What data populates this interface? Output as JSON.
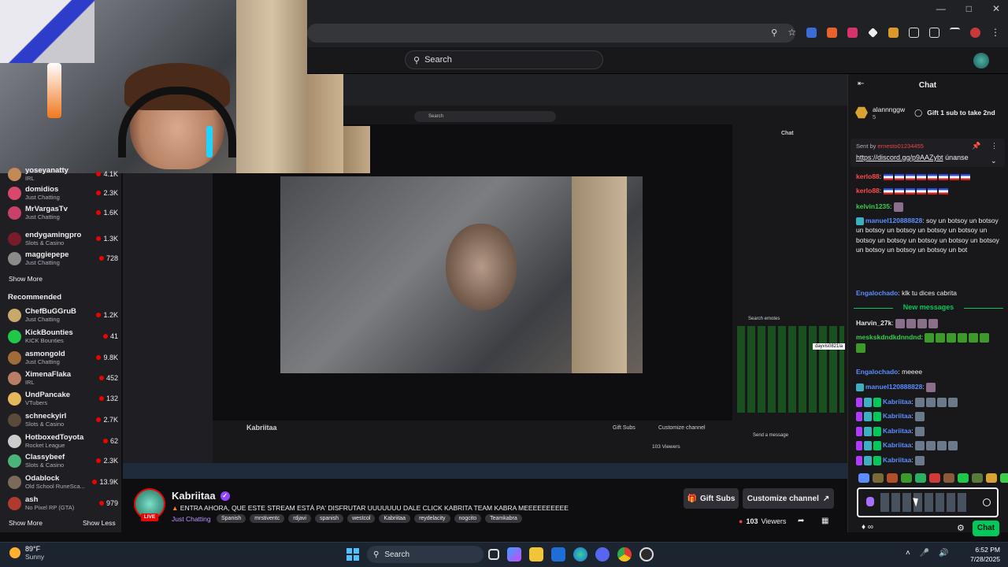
{
  "header": {
    "search_placeholder": "Search"
  },
  "sidebar": {
    "followed": [
      {
        "name": "yoseyanatty",
        "category": "IRL",
        "viewers": "4.1K",
        "color": "#c28a57"
      },
      {
        "name": "domidios",
        "category": "Just Chatting",
        "viewers": "2.3K",
        "color": "#d8486a"
      },
      {
        "name": "MrVargasTv",
        "category": "Just Chatting",
        "viewers": "1.6K",
        "color": "#c9406a"
      },
      {
        "name": "endygamingpro",
        "category": "Slots & Casino",
        "viewers": "1.3K",
        "color": "#7a1b2a"
      },
      {
        "name": "maggiepepe",
        "category": "Just Chatting",
        "viewers": "728",
        "color": "#8a8a8a"
      }
    ],
    "show_more": "Show More",
    "recommended_heading": "Recommended",
    "recommended": [
      {
        "name": "ChefBuGGruB",
        "category": "Just Chatting",
        "viewers": "1.2K",
        "color": "#c9a86b"
      },
      {
        "name": "KickBounties",
        "category": "KICK Bounties",
        "viewers": "41",
        "color": "#20c84a"
      },
      {
        "name": "asmongold",
        "category": "Just Chatting",
        "viewers": "9.8K",
        "color": "#a06b3b"
      },
      {
        "name": "XimenaFlaka",
        "category": "IRL",
        "viewers": "452",
        "color": "#b97d63"
      },
      {
        "name": "UndPancake",
        "category": "VTubers",
        "viewers": "132",
        "color": "#e4b85a"
      },
      {
        "name": "schneckyirl",
        "category": "Slots & Casino",
        "viewers": "2.7K",
        "color": "#5a4a3a"
      },
      {
        "name": "HotboxedToyota",
        "category": "Rocket League",
        "viewers": "62",
        "color": "#cccccc"
      },
      {
        "name": "Classybeef",
        "category": "Slots & Casino",
        "viewers": "2.3K",
        "color": "#4ab37a"
      },
      {
        "name": "Odablock",
        "category": "Old School RuneSca...",
        "viewers": "13.9K",
        "color": "#7a6a5a"
      },
      {
        "name": "ash",
        "category": "No Pixel RP (GTA)",
        "viewers": "979",
        "color": "#b03a2e"
      }
    ],
    "show_more_2": "Show More",
    "show_less": "Show Less"
  },
  "stream": {
    "streamer": "Kabriitaa",
    "live_label": "LIVE",
    "title": "ENTRA AHORA, QUE ESTE STREAM ESTÁ PA' DISFRUTAR UUUUUUU DALE CLICK KABRITA TEAM KABRA MEEEEEEEEEE",
    "category": "Just Chatting",
    "tags": [
      "Spanish",
      "mrstiventc",
      "rdjavi",
      "spanish",
      "westcol",
      "Kabriitaa",
      "reydelacity",
      "nogcito",
      "Teamkabra"
    ],
    "gift_subs": "Gift Subs",
    "customize": "Customize channel",
    "viewers_count": "103",
    "viewers_label": "Viewers"
  },
  "chat": {
    "header": "Chat",
    "gifter": {
      "name": "alannnggw",
      "count": "5",
      "message": "Gift 1 sub to take 2nd"
    },
    "pinned": {
      "sent_by": "Sent by",
      "user": "ernesto01234455",
      "link": "https://discord.gg/p9AAZybt",
      "suffix": "únanse"
    },
    "messages": [
      {
        "user": "kerlo88",
        "text": ""
      },
      {
        "user": "kerlo88",
        "text": ""
      },
      {
        "user": "kelvin1235",
        "text": ""
      },
      {
        "user": "manuel120888828",
        "text": "soy un botsoy un botsoy un botsoy un botsoy un botsoy un botsoy un botsoy un botsoy un botsoy un botsoy un botsoy un botsoy un botsoy un botsoy un bot"
      },
      {
        "user": "Engalochado",
        "text": "klk tu dices cabrita"
      }
    ],
    "new_messages": "New messages",
    "new": [
      {
        "user": "Harvin_27k",
        "text": ""
      },
      {
        "user": "meskskdndkdnndnd",
        "text": ""
      },
      {
        "user": "Engalochado",
        "text": "meeee"
      },
      {
        "user": "manuel120888828",
        "text": ""
      },
      {
        "user": "Kabriitaa",
        "text": ""
      },
      {
        "user": "Kabriitaa",
        "text": ""
      },
      {
        "user": "Kabriitaa",
        "text": ""
      },
      {
        "user": "Kabriitaa",
        "text": ""
      },
      {
        "user": "Kabriitaa",
        "text": ""
      }
    ],
    "points": "∞",
    "send_label": "Chat"
  },
  "taskbar": {
    "temp": "89°F",
    "weather": "Sunny",
    "search": "Search",
    "time": "6:52 PM",
    "date": "7/28/2025"
  },
  "nested": {
    "search": "Search",
    "chat": "Chat",
    "streamer": "Kabriitaa",
    "gift_subs": "Gift Subs",
    "customize": "Customize channel",
    "viewers": "103 Viewers",
    "emote_tooltip": "dayvis0821la",
    "search_emotes": "Search emotes",
    "send_message": "Send a message"
  }
}
